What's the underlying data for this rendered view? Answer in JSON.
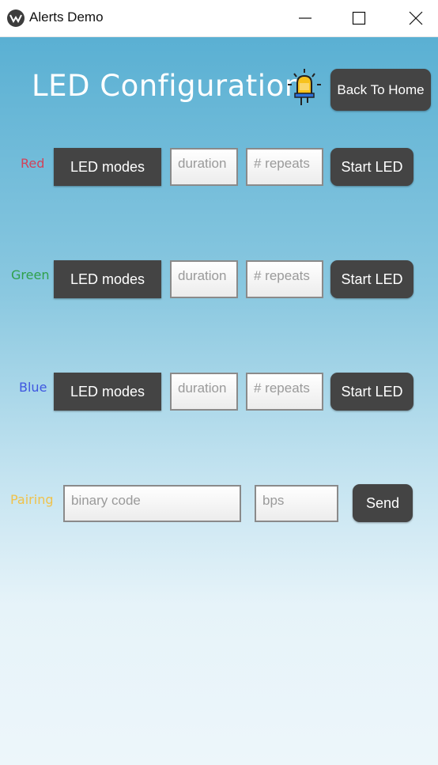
{
  "window": {
    "title": "Alerts Demo"
  },
  "header": {
    "title": "LED Configuration",
    "back_label": "Back To Home"
  },
  "rows": [
    {
      "label": "Red",
      "color": "#d2425a",
      "mode_label": "LED modes",
      "duration_placeholder": "duration",
      "repeats_placeholder": "# repeats",
      "start_label": "Start LED"
    },
    {
      "label": "Green",
      "color": "#2fa04a",
      "mode_label": "LED modes",
      "duration_placeholder": "duration",
      "repeats_placeholder": "# repeats",
      "start_label": "Start LED"
    },
    {
      "label": "Blue",
      "color": "#3f57e0",
      "mode_label": "LED modes",
      "duration_placeholder": "duration",
      "repeats_placeholder": "# repeats",
      "start_label": "Start LED"
    }
  ],
  "pairing": {
    "label": "Pairing",
    "color": "#f0c24a",
    "code_placeholder": "binary code",
    "bps_placeholder": "bps",
    "send_label": "Send"
  }
}
